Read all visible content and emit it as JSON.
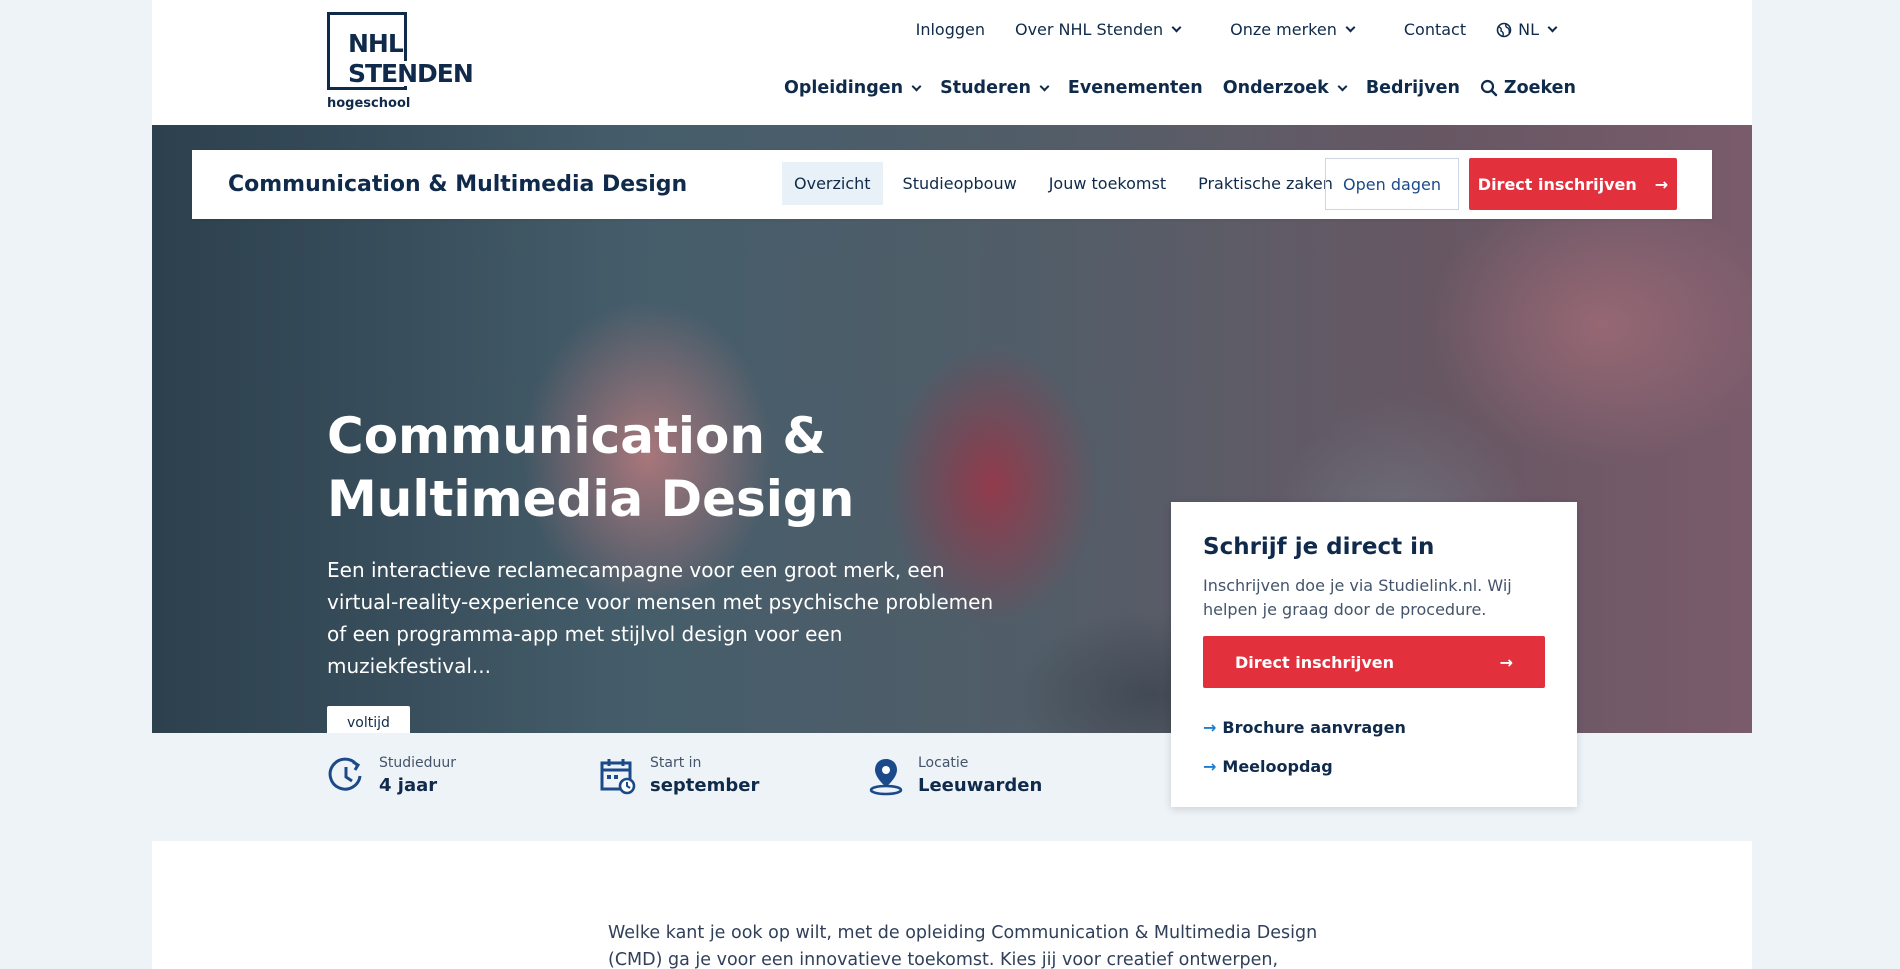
{
  "logo": {
    "line1": "NHL",
    "line2": "STENDEN",
    "sub": "hogeschool"
  },
  "topnav": {
    "login": "Inloggen",
    "about": "Over NHL Stenden",
    "brands": "Onze merken",
    "contact": "Contact",
    "lang": "NL"
  },
  "mainnav": {
    "items": [
      "Opleidingen",
      "Studeren",
      "Evenementen",
      "Onderzoek",
      "Bedrijven"
    ],
    "search": "Zoeken"
  },
  "subnav": {
    "title": "Communication & Multimedia Design",
    "links": [
      "Overzicht",
      "Studieopbouw",
      "Jouw toekomst",
      "Praktische zaken"
    ],
    "open_days": "Open dagen",
    "enroll": "Direct inschrijven"
  },
  "hero": {
    "title_line1": "Communication &",
    "title_line2": "Multimedia Design",
    "intro": "Een interactieve reclamecampagne voor een groot merk, een virtual-reality-experience voor mensen met psychische problemen of een programma-app met stijlvol design voor een muziekfestival...",
    "tag": "voltijd"
  },
  "facts": [
    {
      "label": "Studieduur",
      "value": "4 jaar",
      "icon": "clock-icon"
    },
    {
      "label": "Start in",
      "value": "september",
      "icon": "calendar-icon"
    },
    {
      "label": "Locatie",
      "value": "Leeuwarden",
      "icon": "location-pin-icon"
    }
  ],
  "card": {
    "title": "Schrijf je direct in",
    "text": "Inschrijven doe je via Studielink.nl. Wij helpen je graag door de procedure.",
    "button": "Direct inschrijven",
    "links": [
      "Brochure aanvragen",
      "Meeloopdag"
    ]
  },
  "body": {
    "text": "Welke kant je ook op wilt, met de opleiding Communication & Multimedia Design (CMD) ga je voor een innovatieve toekomst. Kies jij voor creatief ontwerpen,"
  },
  "colors": {
    "navy": "#0f2a4a",
    "red": "#e2313d",
    "link_blue": "#1b7fd1",
    "pale_bg": "#eef3f8"
  }
}
